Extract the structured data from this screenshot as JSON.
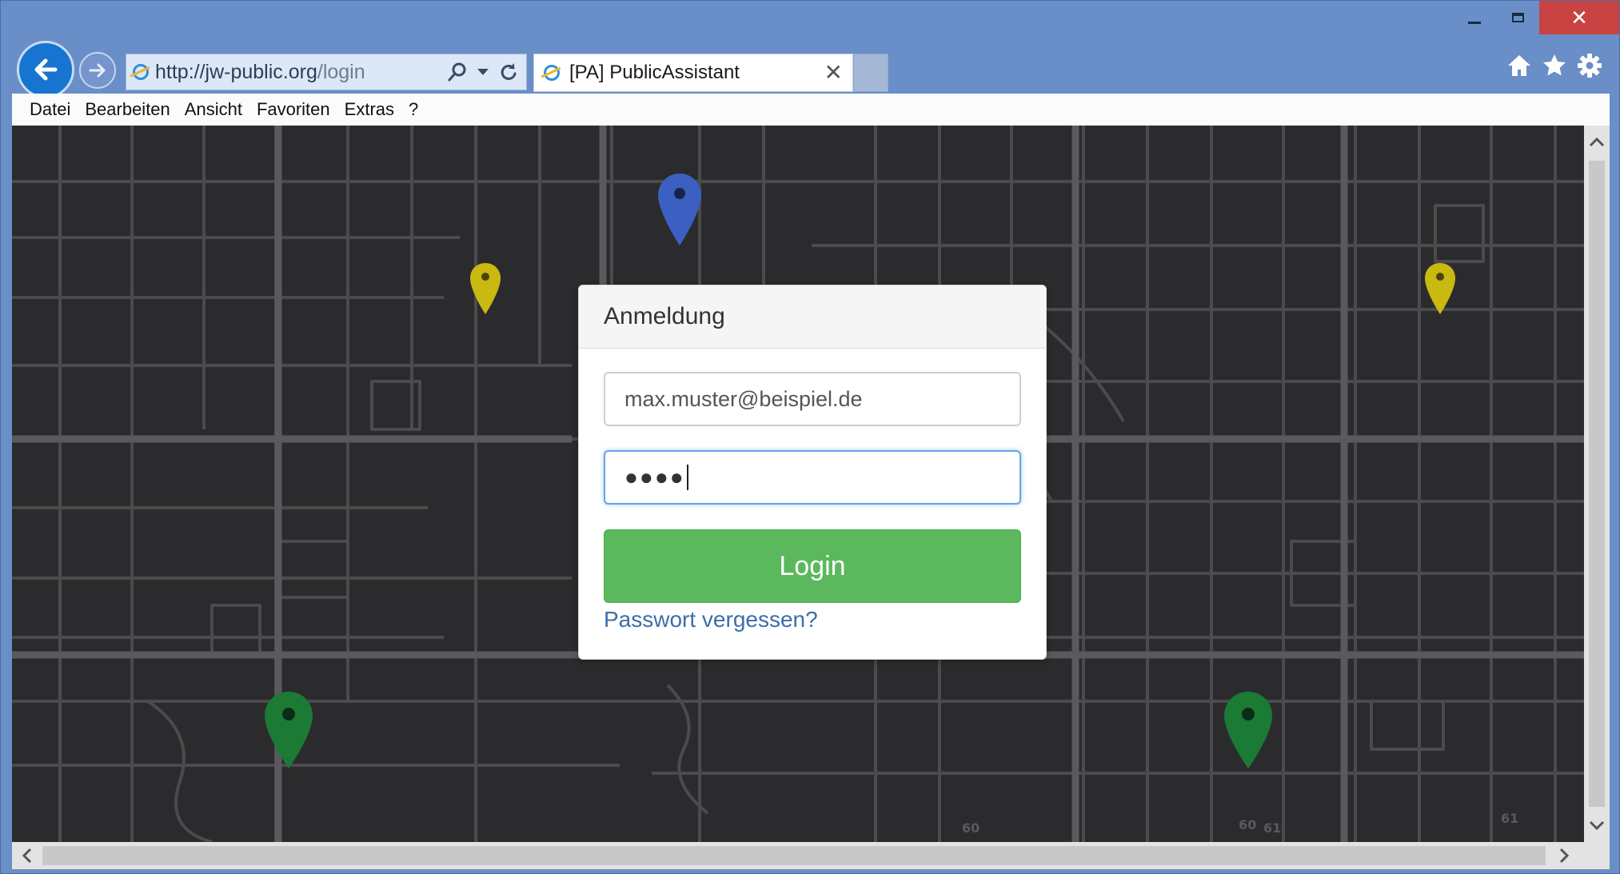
{
  "window": {
    "controls": [
      "minimize",
      "maximize",
      "close"
    ]
  },
  "address": {
    "url_host": "http://jw-public.org",
    "url_path": "/login"
  },
  "tab": {
    "title": "[PA] PublicAssistant"
  },
  "menu": {
    "items": [
      "Datei",
      "Bearbeiten",
      "Ansicht",
      "Favoriten",
      "Extras",
      "?"
    ]
  },
  "login": {
    "title": "Anmeldung",
    "email_value": "max.muster@beispiel.de",
    "password_mask": "●●●●",
    "button_label": "Login",
    "forgot_label": "Passwort vergessen?"
  },
  "map": {
    "road_labels": [
      "60",
      "60",
      "61",
      "61"
    ],
    "pin_colors": {
      "blue": "#3c5fc2",
      "yellow": "#c9b910",
      "green": "#1b7a34"
    }
  },
  "icons": [
    "back-arrow-icon",
    "forward-arrow-icon",
    "ie-icon",
    "search-icon",
    "dropdown-icon",
    "refresh-icon",
    "home-icon",
    "star-icon",
    "gear-icon"
  ]
}
